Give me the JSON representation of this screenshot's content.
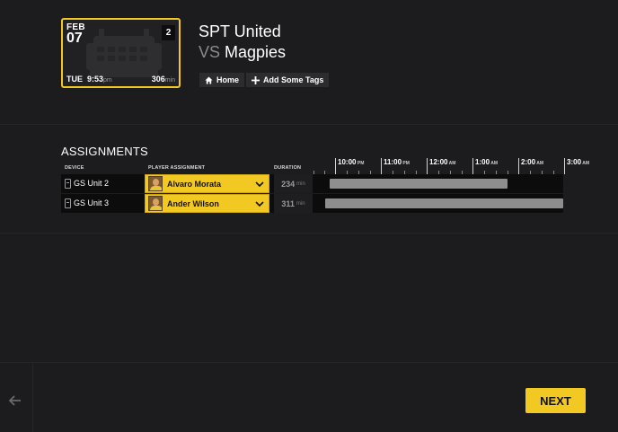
{
  "event": {
    "month": "FEB",
    "day": "07",
    "badge": "2",
    "weekday": "TUE",
    "time": "9:53",
    "ampm": "pm",
    "duration": "306",
    "duration_unit": "min"
  },
  "match": {
    "home": "SPT United",
    "vs": "VS",
    "away": "Magpies"
  },
  "tags": {
    "home_label": "Home",
    "add_label": "Add Some Tags"
  },
  "assignments": {
    "title": "ASSIGNMENTS",
    "columns": {
      "device": "DEVICE",
      "player": "PLAYER ASSIGNMENT",
      "duration": "DURATION"
    },
    "timeline": [
      {
        "time": "10:00",
        "ampm": "PM"
      },
      {
        "time": "11:00",
        "ampm": "PM"
      },
      {
        "time": "12:00",
        "ampm": "AM"
      },
      {
        "time": "1:00",
        "ampm": "AM"
      },
      {
        "time": "2:00",
        "ampm": "AM"
      },
      {
        "time": "3:00",
        "ampm": "AM"
      }
    ],
    "rows": [
      {
        "device": "GS Unit 2",
        "player": "Alvaro Morata",
        "duration": "234",
        "unit": "min"
      },
      {
        "device": "GS Unit 3",
        "player": "Ander Wilson",
        "duration": "311",
        "unit": "min"
      }
    ]
  },
  "footer": {
    "next_label": "NEXT"
  },
  "icons": {
    "home": "home-icon",
    "add": "plus-icon",
    "back": "arrow-left-icon",
    "dropdown": "chevron-down-icon",
    "device": "device-icon"
  },
  "colors": {
    "accent": "#f2c922",
    "background": "#1c1c1e"
  }
}
